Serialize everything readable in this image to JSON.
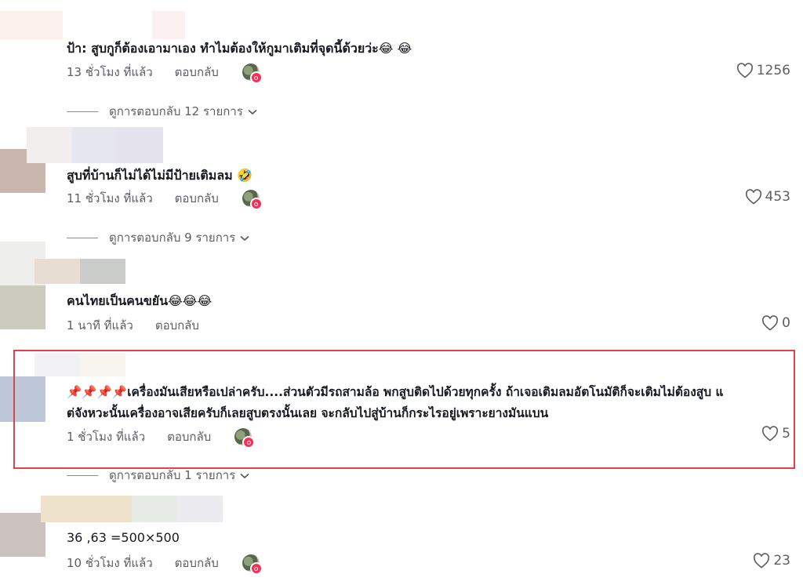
{
  "comments": [
    {
      "text": "ป้า: สูบกูก็ต้องเอามาเอง ทำไมต้องให้กูมาเติมที่จุดนี้ด้วยว่ะ",
      "emoji": "😂 😂",
      "time": "13 ชั่วโมง ที่แล้ว",
      "reply": "ตอบกลับ",
      "likes": "1256",
      "replies": "ดูการตอบกลับ 12 รายการ"
    },
    {
      "text": "สูบที่บ้านก็ไม่ได้ไม่มีป้ายเติมลม",
      "emoji": "🤣",
      "time": "11 ชั่วโมง ที่แล้ว",
      "reply": "ตอบกลับ",
      "likes": "453",
      "replies": "ดูการตอบกลับ 9 รายการ"
    },
    {
      "text": "คนไทยเป็นคนขยัน",
      "emoji": "😂😂😂",
      "time": "1 นาที ที่แล้ว",
      "reply": "ตอบกลับ",
      "likes": "0"
    },
    {
      "pins": "📌📌📌📌",
      "text_line1": "เครื่องมันเสียหรือเปล่าครับ....ส่วนตัวมีรถสามล้อ พกสูบติดไปด้วยทุกครั้ง ถ้าเจอเติมลมอัตโนมัติก็จะเติมไม่ต้องสูบ แ",
      "text_line2": "ต่จังหวะนั้นเครื่องอาจเสียครับก็เลยสูบตรงนั้นเลย จะกลับไปสู่บ้านก็กระไรอยู่เพราะยางมันแบน",
      "time": "1 ชั่วโมง ที่แล้ว",
      "reply": "ตอบกลับ",
      "likes": "5",
      "replies": "ดูการตอบกลับ 1 รายการ"
    },
    {
      "text": "36 ,63 =500×500",
      "time": "10 ชั่วโมง ที่แล้ว",
      "reply": "ตอบกลับ",
      "likes": "23"
    }
  ],
  "colors": {
    "highlight": "#e04448",
    "text": "#161823",
    "muted": "#5c5d66",
    "badge": "#fe2c55"
  }
}
